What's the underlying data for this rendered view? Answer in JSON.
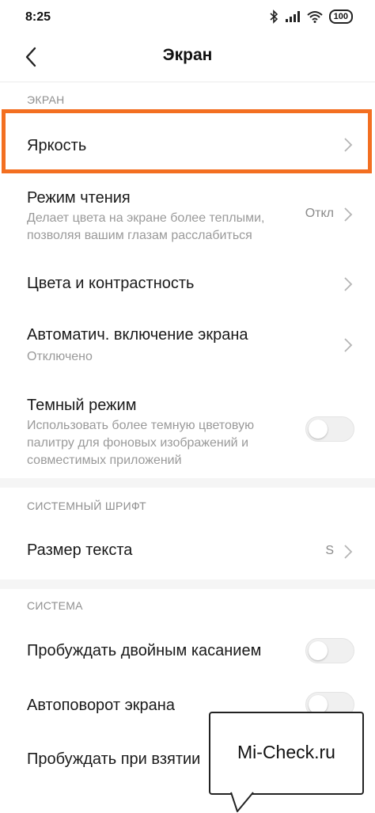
{
  "status_bar": {
    "time": "8:25",
    "battery": "100",
    "icons": [
      "bluetooth-icon",
      "signal-icon",
      "wifi-icon",
      "battery-icon"
    ]
  },
  "header": {
    "title": "Экран",
    "back_icon": "back-arrow-icon"
  },
  "sections": {
    "screen": {
      "title": "ЭКРАН",
      "brightness": {
        "title": "Яркость"
      },
      "reading_mode": {
        "title": "Режим чтения",
        "subtitle_line1": "Делает цвета на экране более теплыми,",
        "subtitle_line2": "позволяя вашим глазам расслабиться",
        "value": "Откл"
      },
      "colors": {
        "title": "Цвета и контрастность"
      },
      "auto_on": {
        "title": "Автоматич. включение экрана",
        "subtitle": "Отключено"
      },
      "dark_mode": {
        "title": "Темный режим",
        "subtitle_line1": "Использовать более темную цветовую",
        "subtitle_line2": "палитру для фоновых изображений и",
        "subtitle_line3": "совместимых приложений",
        "enabled": false
      }
    },
    "font": {
      "title": "СИСТЕМНЫЙ ШРИФТ",
      "text_size": {
        "title": "Размер текста",
        "value": "S"
      }
    },
    "system": {
      "title": "СИСТЕМА",
      "double_tap": {
        "title": "Пробуждать двойным касанием",
        "enabled": false
      },
      "auto_rotate": {
        "title": "Автоповорот экрана",
        "enabled": false
      },
      "lift_to_wake": {
        "title": "Пробуждать при взятии"
      }
    }
  },
  "overlay": {
    "watermark": "Mi-Check.ru",
    "highlight_color": "#f36f21"
  }
}
